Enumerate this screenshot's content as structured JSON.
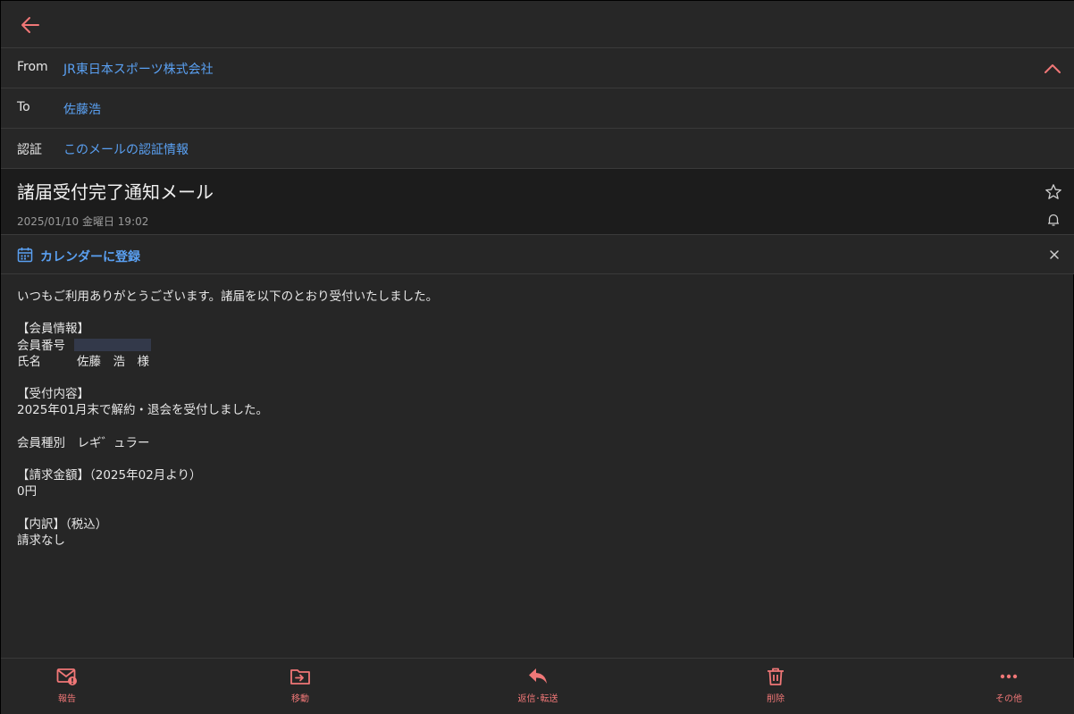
{
  "header": {
    "from_label": "From",
    "from_value": "JR東日本スポーツ株式会社",
    "to_label": "To",
    "to_value": "佐藤浩",
    "auth_label": "認証",
    "auth_value": "このメールの認証情報"
  },
  "message": {
    "subject": "諸届受付完了通知メール",
    "datetime": "2025/01/10 金曜日 19:02"
  },
  "calendar": {
    "label": "カレンダーに登録"
  },
  "body": {
    "greeting": "いつもご利用ありがとうございます。諸届を以下のとおり受付いたしました。",
    "member_info_heading": "【会員情報】",
    "member_number_label": "会員番号",
    "name_label": "氏名",
    "name_value": "佐藤　浩　様",
    "reception_heading": "【受付内容】",
    "reception_text": "2025年01月末で解約・退会を受付しました。",
    "member_type": "会員種別　レギ゛ュラー",
    "billing_heading": "【請求金額】（2025年02月より）",
    "billing_amount": "0円",
    "breakdown_heading": "【内訳】（税込）",
    "breakdown_text": "請求なし"
  },
  "toolbar": {
    "report": "報告",
    "move": "移動",
    "reply": "返信･転送",
    "delete": "削除",
    "more": "その他"
  },
  "colors": {
    "accent": "#f07777",
    "link": "#5aa0f2",
    "background": "#262626"
  }
}
